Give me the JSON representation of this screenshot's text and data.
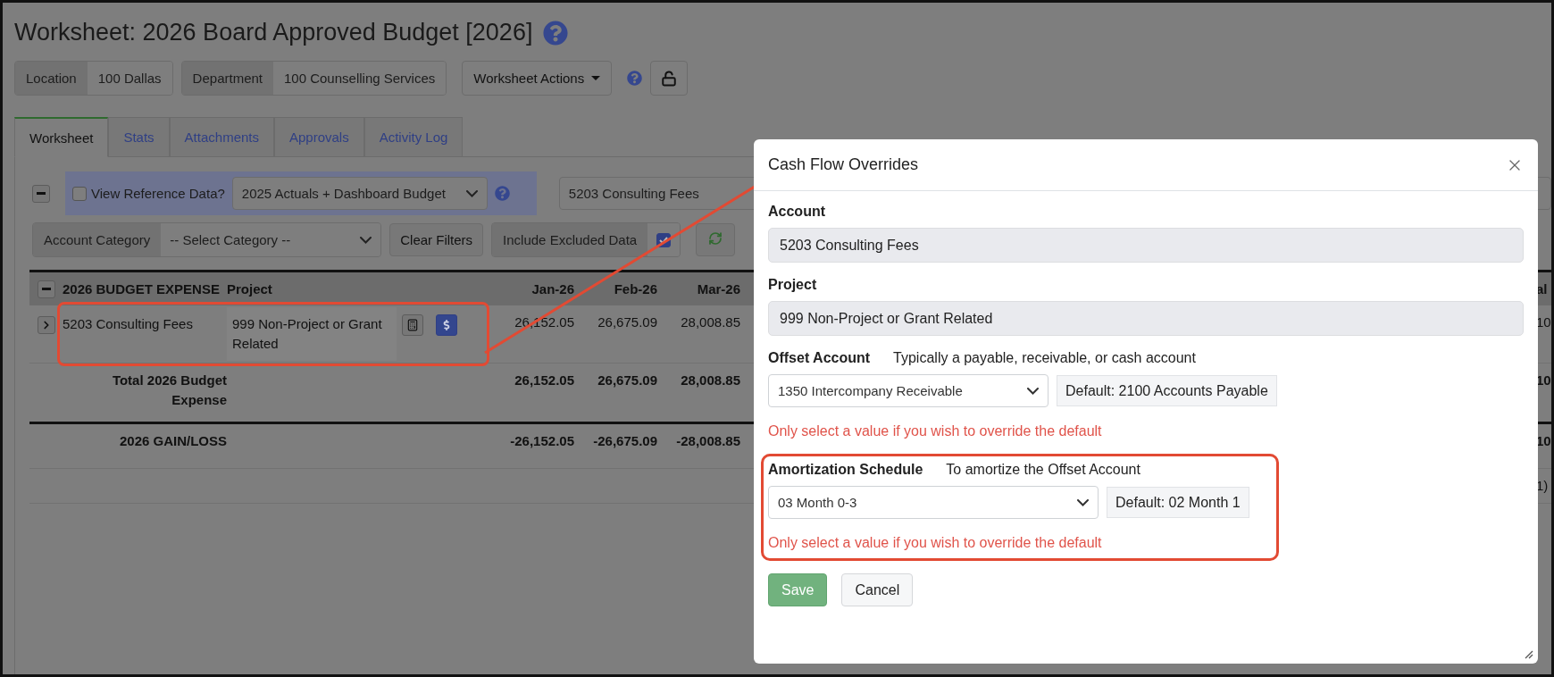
{
  "page_title": "Worksheet: 2026 Board Approved Budget [2026]",
  "filters": [
    {
      "label": "Location",
      "value": "100 Dallas"
    },
    {
      "label": "Department",
      "value": "100 Counselling Services"
    }
  ],
  "actions_button": "Worksheet Actions",
  "tabs": [
    {
      "label": "Worksheet",
      "selected": true
    },
    {
      "label": "Stats",
      "selected": false
    },
    {
      "label": "Attachments",
      "selected": false
    },
    {
      "label": "Approvals",
      "selected": false
    },
    {
      "label": "Activity Log",
      "selected": false
    }
  ],
  "reference": {
    "checkbox_label": "View Reference Data?",
    "checked": false,
    "dataset": "2025 Actuals + Dashboard Budget",
    "account_field": "5203 Consulting Fees"
  },
  "category_filter": {
    "label": "Account Category",
    "placeholder": "-- Select Category --"
  },
  "clear_button": "Clear Filters",
  "include_excluded": {
    "label": "Include Excluded Data",
    "checked": true
  },
  "table": {
    "columns": [
      "2026 BUDGET EXPENSE",
      "Project",
      "Jan-26",
      "Feb-26",
      "Mar-26",
      "al"
    ],
    "rows": [
      {
        "kind": "account",
        "account": "5203 Consulting Fees",
        "project": "999 Non-Project or Grant Related",
        "highlighted": true,
        "values": [
          "26,152.05",
          "26,675.09",
          "28,008.85"
        ],
        "edge": "10"
      },
      {
        "kind": "total",
        "account": "Total 2026 Budget Expense",
        "values": [
          "26,152.05",
          "26,675.09",
          "28,008.85"
        ],
        "edge": "10"
      },
      {
        "kind": "result",
        "account": "2026 GAIN/LOSS",
        "values": [
          "-26,152.05",
          "-26,675.09",
          "-28,008.85"
        ],
        "edge": "10"
      },
      {
        "kind": "blank",
        "edge": "1)"
      }
    ]
  },
  "modal": {
    "title": "Cash Flow Overrides",
    "fields": [
      {
        "kind": "readonly",
        "label": "Account",
        "value": "5203 Consulting Fees"
      },
      {
        "kind": "readonly",
        "label": "Project",
        "value": "999 Non-Project or Grant Related"
      },
      {
        "kind": "select",
        "label": "Offset Account",
        "hint": "Typically a payable, receivable, or cash account",
        "value": "1350 Intercompany Receivable",
        "default": "Default: 2100 Accounts Payable",
        "warning": "Only select a value if you wish to override the default",
        "highlighted": false
      },
      {
        "kind": "select",
        "label": "Amortization Schedule",
        "hint": "To amortize the Offset Account",
        "value": "03 Month 0-3",
        "default": "Default: 02 Month 1",
        "warning": "Only select a value if you wish to override the default",
        "highlighted": true
      }
    ],
    "buttons": [
      {
        "label": "Save",
        "kind": "primary"
      },
      {
        "label": "Cancel",
        "kind": "secondary"
      }
    ]
  }
}
